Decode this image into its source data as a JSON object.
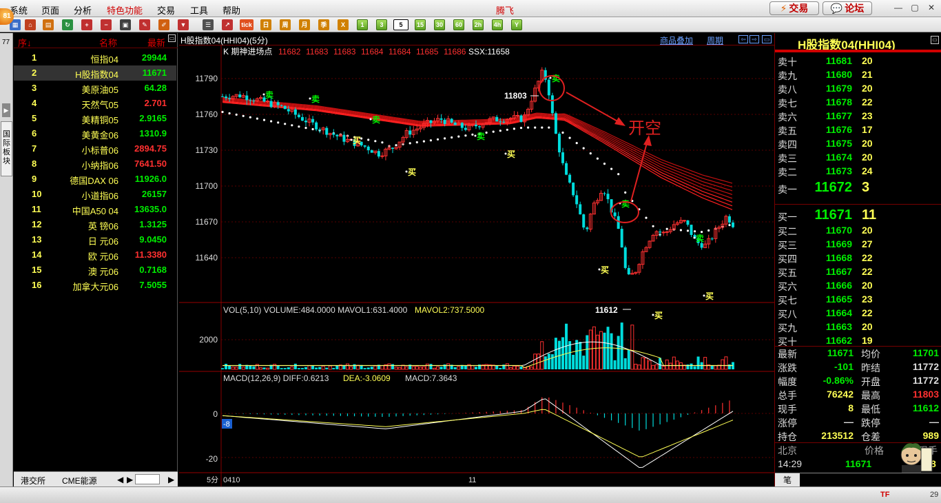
{
  "menu": [
    "系统",
    "页面",
    "分析",
    "特色功能",
    "交易",
    "工具",
    "帮助"
  ],
  "app_title": "腾飞",
  "logo_badge": "81",
  "top_buttons": {
    "trade": "交易",
    "forum": "论坛"
  },
  "toolbar": {
    "period_buttons": [
      "1",
      "3",
      "5",
      "15",
      "30",
      "60",
      "2h",
      "4h",
      "Y"
    ],
    "selected_period": "5",
    "icon_labels": [
      "tick",
      "日",
      "周",
      "月",
      "季",
      "X"
    ]
  },
  "left_strip": {
    "code": "77",
    "tab_label": "国际板块"
  },
  "list": {
    "headers": {
      "seq": "序↓",
      "name": "名称",
      "latest": "最新"
    },
    "rows": [
      {
        "num": "1",
        "name": "恒指04",
        "value": "29944",
        "color": "#00ee00"
      },
      {
        "num": "2",
        "name": "H股指数04",
        "value": "11671",
        "color": "#00ee00"
      },
      {
        "num": "3",
        "name": "美原油05",
        "value": "64.28",
        "color": "#00ee00"
      },
      {
        "num": "4",
        "name": "天然气05",
        "value": "2.701",
        "color": "#ff3030"
      },
      {
        "num": "5",
        "name": "美精铜05",
        "value": "2.9165",
        "color": "#00ee00"
      },
      {
        "num": "6",
        "name": "美黄金06",
        "value": "1310.9",
        "color": "#00ee00"
      },
      {
        "num": "7",
        "name": "小标普06",
        "value": "2894.75",
        "color": "#ff3030"
      },
      {
        "num": "8",
        "name": "小纳指06",
        "value": "7641.50",
        "color": "#ff3030"
      },
      {
        "num": "9",
        "name": "德国DAX 06",
        "value": "11926.0",
        "color": "#00ee00"
      },
      {
        "num": "10",
        "name": "小道指06",
        "value": "26157",
        "color": "#00ee00"
      },
      {
        "num": "11",
        "name": "中国A50 04",
        "value": "13635.0",
        "color": "#00ee00"
      },
      {
        "num": "12",
        "name": "英   镑06",
        "value": "1.3125",
        "color": "#00ee00"
      },
      {
        "num": "13",
        "name": "日   元06",
        "value": "9.0450",
        "color": "#00ee00"
      },
      {
        "num": "14",
        "name": "欧   元06",
        "value": "11.3380",
        "color": "#ff3030"
      },
      {
        "num": "15",
        "name": "澳   元06",
        "value": "0.7168",
        "color": "#00ee00"
      },
      {
        "num": "16",
        "name": "加拿大元06",
        "value": "7.5055",
        "color": "#00ee00"
      }
    ],
    "footer_tabs": [
      "港交所",
      "CME能源"
    ]
  },
  "chart_header": {
    "title": "H股指数04(HHI04)(5分)",
    "links": [
      "商品叠加",
      "周期"
    ]
  },
  "chart": {
    "main_label": "K  期神进场点",
    "main_values": [
      "11682",
      "11683",
      "11683",
      "11684",
      "11684",
      "11685",
      "11686"
    ],
    "ssx": "SSX:11658",
    "y_ticks": [
      "11790",
      "11760",
      "11730",
      "11700",
      "11670",
      "11640"
    ],
    "high_label": "11803",
    "low_label": "11612",
    "annotation": "开空",
    "sell_label": "卖",
    "buy_label": "买",
    "vol_text": "VOL(5,10) VOLUME:484.0000 MAVOL1:631.4000",
    "vol_text2": "MAVOL2:737.5000",
    "vol_tick": "2000",
    "macd_text": "MACD(12,26,9) DIFF:0.6213",
    "macd_dea": "DEA:-3.0609",
    "macd_val": "MACD:7.3643",
    "macd_ticks": [
      "0",
      "-20"
    ],
    "macd_marker": "-8",
    "x_period": "5分",
    "x_labels": [
      "0410",
      "11"
    ]
  },
  "right": {
    "title": "H股指数04(HHI04)",
    "asks": [
      {
        "label": "卖十",
        "price": "11681",
        "vol": "20"
      },
      {
        "label": "卖九",
        "price": "11680",
        "vol": "21"
      },
      {
        "label": "卖八",
        "price": "11679",
        "vol": "20"
      },
      {
        "label": "卖七",
        "price": "11678",
        "vol": "22"
      },
      {
        "label": "卖六",
        "price": "11677",
        "vol": "23"
      },
      {
        "label": "卖五",
        "price": "11676",
        "vol": "17"
      },
      {
        "label": "卖四",
        "price": "11675",
        "vol": "20"
      },
      {
        "label": "卖三",
        "price": "11674",
        "vol": "20"
      },
      {
        "label": "卖二",
        "price": "11673",
        "vol": "24"
      },
      {
        "label": "卖一",
        "price": "11672",
        "vol": "3"
      }
    ],
    "bids": [
      {
        "label": "买一",
        "price": "11671",
        "vol": "11"
      },
      {
        "label": "买二",
        "price": "11670",
        "vol": "20"
      },
      {
        "label": "买三",
        "price": "11669",
        "vol": "27"
      },
      {
        "label": "买四",
        "price": "11668",
        "vol": "22"
      },
      {
        "label": "买五",
        "price": "11667",
        "vol": "22"
      },
      {
        "label": "买六",
        "price": "11666",
        "vol": "20"
      },
      {
        "label": "买七",
        "price": "11665",
        "vol": "23"
      },
      {
        "label": "买八",
        "price": "11664",
        "vol": "22"
      },
      {
        "label": "买九",
        "price": "11663",
        "vol": "20"
      },
      {
        "label": "买十",
        "price": "11662",
        "vol": "19"
      }
    ],
    "stats": [
      {
        "l1": "最新",
        "v1": "11671",
        "c1": "#00ee00",
        "l2": "均价",
        "v2": "11701",
        "c2": "#00ee00"
      },
      {
        "l1": "涨跌",
        "v1": "-101",
        "c1": "#00ee00",
        "l2": "昨结",
        "v2": "11772",
        "c2": "#dddddd"
      },
      {
        "l1": "幅度",
        "v1": "-0.86%",
        "c1": "#00ee00",
        "l2": "开盘",
        "v2": "11772",
        "c2": "#dddddd"
      },
      {
        "l1": "总手",
        "v1": "76242",
        "c1": "#ffff55",
        "l2": "最高",
        "v2": "11803",
        "c2": "#ff3030"
      },
      {
        "l1": "现手",
        "v1": "8",
        "c1": "#ffff55",
        "l2": "最低",
        "v2": "11612",
        "c2": "#00ee00"
      },
      {
        "l1": "涨停",
        "v1": "—",
        "c1": "#dddddd",
        "l2": "跌停",
        "v2": "—",
        "c2": "#dddddd"
      },
      {
        "l1": "持仓",
        "v1": "213512",
        "c1": "#ffff55",
        "l2": "仓差",
        "v2": "989",
        "c2": "#ffff55"
      }
    ],
    "trade_header": {
      "loc": "北京",
      "price": "价格",
      "vol": "现手"
    },
    "trade_row": {
      "time": "14:29",
      "price": "11671",
      "vol": "8"
    },
    "bottom_tab": "笔"
  },
  "status": {
    "right_text": "29"
  }
}
